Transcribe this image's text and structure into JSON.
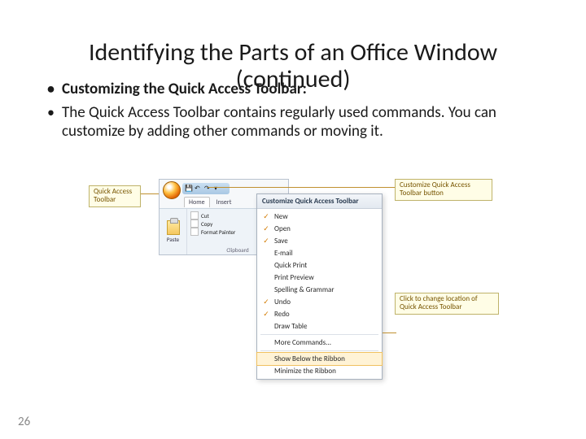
{
  "title_line1": "Identifying the Parts of an Office Window",
  "title_line2": "(continued)",
  "bullets": {
    "b1": "Customizing the Quick Access Toolbar:",
    "b2": "The Quick Access Toolbar contains regularly used commands. You can customize by adding other commands or moving it."
  },
  "page_number": "26",
  "callouts": {
    "qat": "Quick Access\nToolbar",
    "cust_btn": "Customize Quick Access\nToolbar button",
    "location": "Click to change location\nof Quick Access Toolbar"
  },
  "ribbon": {
    "home_tab": "Home",
    "insert_tab": "Insert",
    "paste": "Paste",
    "cut": "Cut",
    "copy": "Copy",
    "format_painter": "Format Painter",
    "clipboard_group": "Clipboard"
  },
  "dropdown": {
    "title": "Customize Quick Access Toolbar",
    "items": [
      {
        "checked": true,
        "label": "New"
      },
      {
        "checked": true,
        "label": "Open"
      },
      {
        "checked": true,
        "label": "Save"
      },
      {
        "checked": false,
        "label": "E-mail"
      },
      {
        "checked": false,
        "label": "Quick Print"
      },
      {
        "checked": false,
        "label": "Print Preview"
      },
      {
        "checked": false,
        "label": "Spelling & Grammar"
      },
      {
        "checked": true,
        "label": "Undo"
      },
      {
        "checked": true,
        "label": "Redo"
      },
      {
        "checked": false,
        "label": "Draw Table"
      },
      {
        "checked": false,
        "label": "More Commands..."
      },
      {
        "checked": false,
        "label": "Show Below the Ribbon",
        "selected": true
      },
      {
        "checked": false,
        "label": "Minimize the Ribbon"
      }
    ]
  }
}
